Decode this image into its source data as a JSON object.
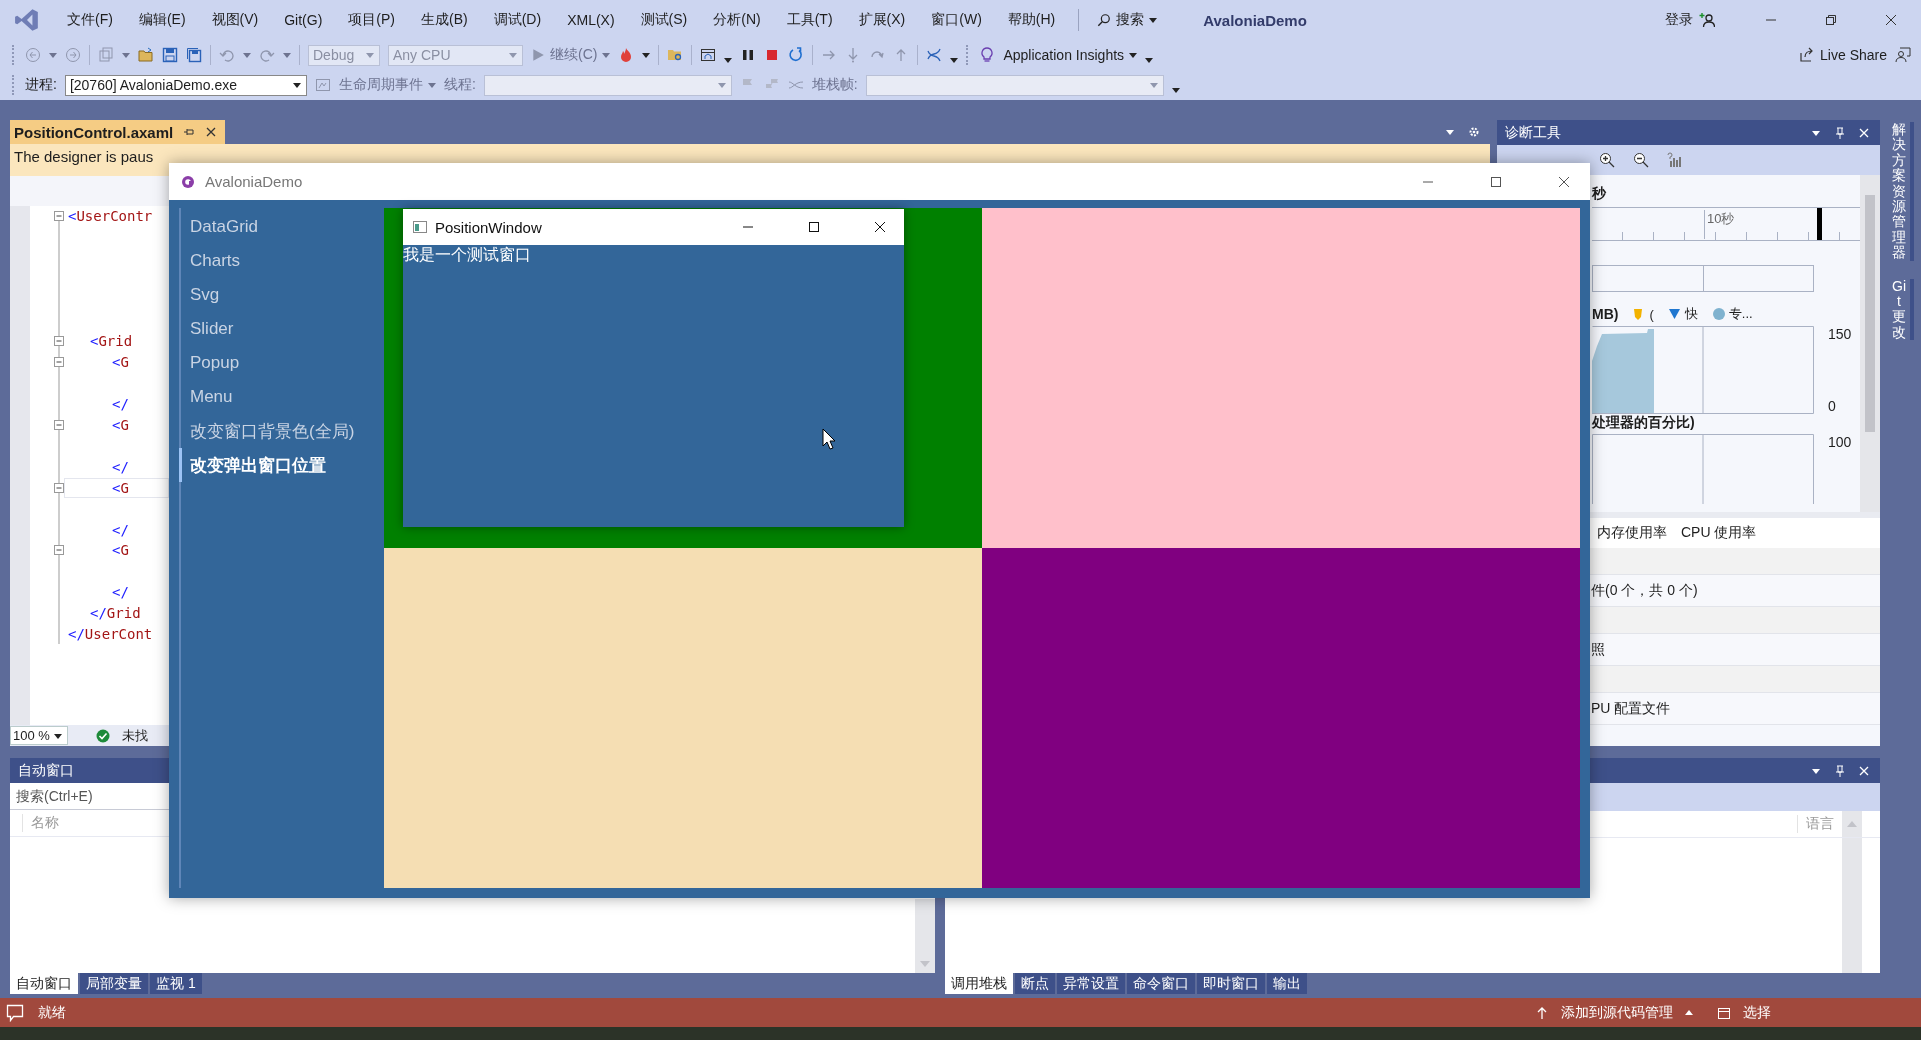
{
  "ide": {
    "menu": [
      "文件(F)",
      "编辑(E)",
      "视图(V)",
      "Git(G)",
      "项目(P)",
      "生成(B)",
      "调试(D)",
      "XML(X)",
      "测试(S)",
      "分析(N)",
      "工具(T)",
      "扩展(X)",
      "窗口(W)",
      "帮助(H)"
    ],
    "search": "搜索",
    "title": "AvaloniaDemo",
    "sign_in": "登录"
  },
  "toolbar": {
    "configuration": {
      "label": "Debug",
      "disabled": true
    },
    "platform": {
      "label": "Any CPU",
      "disabled": true
    },
    "continue": "继续(C)",
    "insights": "Application Insights",
    "live_share": "Live Share"
  },
  "debug_bar": {
    "process_label": "进程:",
    "process": "[20760] AvaloniaDemo.exe",
    "lifecycle": "生命周期事件",
    "thread_label": "线程:",
    "stack_label": "堆栈帧:"
  },
  "editor": {
    "tab": {
      "title": "PositionControl.axaml",
      "selected": true
    },
    "info": "The designer is paus",
    "lines": [
      {
        "text": "<UserContr",
        "fold": true,
        "current": false
      },
      {
        "text": "<Grid",
        "fold": true,
        "current": false
      },
      {
        "text": "<G",
        "fold": true,
        "current": false
      },
      {
        "text": "</",
        "fold": false,
        "current": false
      },
      {
        "text": "<G",
        "fold": true,
        "current": false
      },
      {
        "text": "</",
        "fold": false,
        "current": false
      },
      {
        "text": "<G",
        "fold": true,
        "current": true
      },
      {
        "text": "</",
        "fold": false,
        "current": false
      },
      {
        "text": "<G",
        "fold": true,
        "current": false
      },
      {
        "text": "</",
        "fold": false,
        "current": false
      },
      {
        "text": "</Grid",
        "fold": false,
        "current": false
      },
      {
        "text": "</UserCont",
        "fold": false,
        "current": false
      }
    ],
    "zoom": "100 %",
    "status": "未找"
  },
  "diagnostics": {
    "title": "诊断工具",
    "time_unit": "秒",
    "tick": "10秒",
    "memory_title": "MB)",
    "legend": [
      {
        "label": "(",
        "kind": "marker",
        "color": "#f2b200"
      },
      {
        "label": "快",
        "kind": "triangle",
        "color": "#1f77d0"
      },
      {
        "label": "专...",
        "kind": "circle",
        "color": "#7fb2cf"
      }
    ],
    "memory_max": "150",
    "memory_min": "0",
    "cpu_title": "处理器的百分比)",
    "cpu_max": "100",
    "tabs": [
      "内存使用率",
      "CPU 使用率"
    ],
    "rows": [
      "件(0 个，共 0 个)",
      "照",
      "PU 配置文件"
    ]
  },
  "side_tabs": [
    "解决方案资源管理器",
    "Git 更改"
  ],
  "autos": {
    "title": "自动窗口",
    "search": {
      "placeholder": "搜索(Ctrl+E)"
    },
    "column": "名称",
    "tabs": [
      {
        "label": "自动窗口",
        "selected": true
      },
      {
        "label": "局部变量",
        "selected": false
      },
      {
        "label": "监视 1",
        "selected": false
      }
    ]
  },
  "call_stack": {
    "column": "语言",
    "tabs": [
      {
        "label": "调用堆栈",
        "selected": true
      },
      {
        "label": "断点",
        "selected": false
      },
      {
        "label": "异常设置",
        "selected": false
      },
      {
        "label": "命令窗口",
        "selected": false
      },
      {
        "label": "即时窗口",
        "selected": false
      },
      {
        "label": "输出",
        "selected": false
      }
    ]
  },
  "status_bar": {
    "text": "就绪",
    "source_control": "添加到源代码管理",
    "repository": "选择"
  },
  "app_window": {
    "title": "AvaloniaDemo",
    "nav": [
      {
        "label": "DataGrid",
        "selected": false
      },
      {
        "label": "Charts",
        "selected": false
      },
      {
        "label": "Svg",
        "selected": false
      },
      {
        "label": "Slider",
        "selected": false
      },
      {
        "label": "Popup",
        "selected": false
      },
      {
        "label": "Menu",
        "selected": false
      },
      {
        "label": "改变窗口背景色(全局)",
        "selected": false
      },
      {
        "label": "改变弹出窗口位置",
        "selected": true
      }
    ],
    "quadrants": [
      {
        "color": "#008000"
      },
      {
        "color": "#ffc0cb"
      },
      {
        "color": "#f5deb3"
      },
      {
        "color": "#800080"
      }
    ],
    "popup": {
      "title": "PositionWindow",
      "text": "我是一个测试窗口"
    }
  }
}
